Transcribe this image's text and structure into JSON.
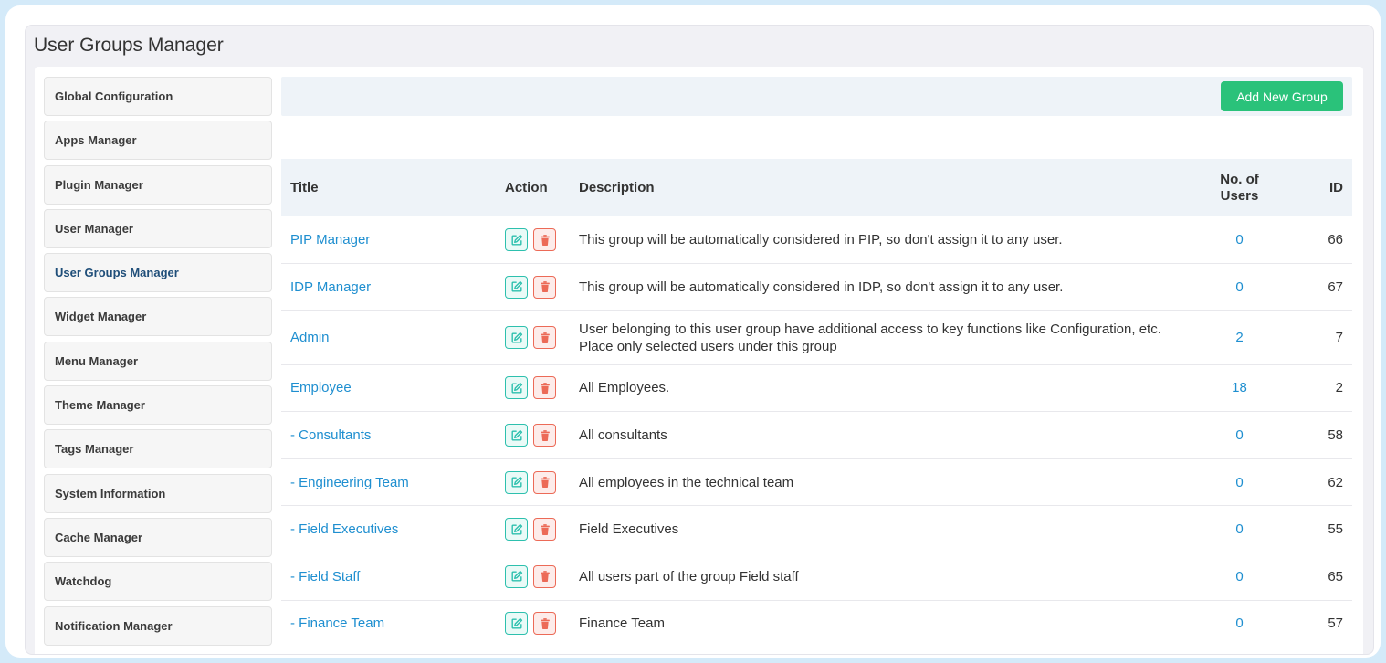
{
  "page": {
    "title": "User Groups Manager"
  },
  "sidebar": {
    "items": [
      {
        "label": "Global Configuration"
      },
      {
        "label": "Apps Manager"
      },
      {
        "label": "Plugin Manager"
      },
      {
        "label": "User Manager"
      },
      {
        "label": "User Groups Manager",
        "active": true
      },
      {
        "label": "Widget Manager"
      },
      {
        "label": "Menu Manager"
      },
      {
        "label": "Theme Manager"
      },
      {
        "label": "Tags Manager"
      },
      {
        "label": "System Information"
      },
      {
        "label": "Cache Manager"
      },
      {
        "label": "Watchdog"
      },
      {
        "label": "Notification Manager"
      }
    ]
  },
  "toolbar": {
    "add_label": "Add New Group"
  },
  "table": {
    "headers": {
      "title": "Title",
      "action": "Action",
      "description": "Description",
      "users": "No. of Users",
      "id": "ID"
    },
    "rows": [
      {
        "title": "PIP Manager",
        "description": "This group will be automatically considered in PIP, so don't assign it to any user.",
        "users": "0",
        "id": "66"
      },
      {
        "title": "IDP Manager",
        "description": "This group will be automatically considered in IDP, so don't assign it to any user.",
        "users": "0",
        "id": "67"
      },
      {
        "title": "Admin",
        "description": "User belonging to this user group have additional access to key functions like Configuration, etc. Place only selected users under this group",
        "users": "2",
        "id": "7"
      },
      {
        "title": "Employee",
        "description": "All Employees.",
        "users": "18",
        "id": "2"
      },
      {
        "title": "- Consultants",
        "description": "All consultants",
        "users": "0",
        "id": "58"
      },
      {
        "title": "- Engineering Team",
        "description": "All employees in the technical team",
        "users": "0",
        "id": "62"
      },
      {
        "title": "- Field Executives",
        "description": "Field Executives",
        "users": "0",
        "id": "55"
      },
      {
        "title": "- Field Staff",
        "description": "All users part of the group Field staff",
        "users": "0",
        "id": "65"
      },
      {
        "title": "- Finance Team",
        "description": "Finance Team",
        "users": "0",
        "id": "57"
      }
    ]
  },
  "colors": {
    "accent_green": "#2ac27a",
    "link_blue": "#1f8fd0",
    "edit_teal": "#2dc0ae",
    "delete_red": "#ec6a57"
  },
  "icons": {
    "edit": "edit-icon",
    "delete": "trash-icon"
  }
}
